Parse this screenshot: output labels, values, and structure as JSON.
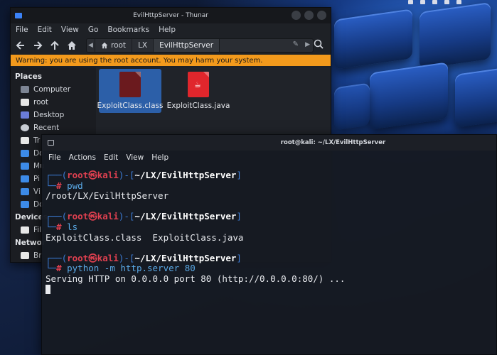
{
  "desktop": {
    "icons": [
      "indicator-icon",
      "network-icon",
      "sound-icon",
      "notification-icon",
      "battery-icon"
    ]
  },
  "thunar": {
    "window_title": "EvilHttpServer - Thunar",
    "menu": [
      "File",
      "Edit",
      "View",
      "Go",
      "Bookmarks",
      "Help"
    ],
    "path": [
      "root",
      "LX",
      "EvilHttpServer"
    ],
    "warning": "Warning: you are using the root account. You may harm your system.",
    "sidebar": {
      "places_header": "Places",
      "places": [
        {
          "label": "Computer",
          "icon": "computer-icon"
        },
        {
          "label": "root",
          "icon": "home-folder-icon"
        },
        {
          "label": "Desktop",
          "icon": "desktop-icon"
        },
        {
          "label": "Recent",
          "icon": "recent-icon"
        },
        {
          "label": "Tr",
          "icon": "trash-icon"
        },
        {
          "label": "Do",
          "icon": "folder-icon"
        },
        {
          "label": "Mu",
          "icon": "music-icon"
        },
        {
          "label": "Pi",
          "icon": "pictures-icon"
        },
        {
          "label": "Vi",
          "icon": "videos-icon"
        },
        {
          "label": "Do",
          "icon": "downloads-icon"
        }
      ],
      "devices_header": "Devices",
      "devices": [
        {
          "label": "Fil",
          "icon": "drive-icon"
        }
      ],
      "network_header": "Networ",
      "network": [
        {
          "label": "Br",
          "icon": "browse-network-icon"
        }
      ]
    },
    "files": [
      {
        "name": "ExploitClass.class",
        "icon": "class-file-icon",
        "selected": true
      },
      {
        "name": "ExploitClass.java",
        "icon": "java-file-icon",
        "selected": false
      }
    ],
    "colors": {
      "warning_bg": "#f39a1c",
      "selection": "#2c5fa8"
    }
  },
  "terminal": {
    "window_title": "root@kali: ~/LX/EvilHttpServer",
    "menu": [
      "File",
      "Actions",
      "Edit",
      "View",
      "Help"
    ],
    "prompt": {
      "user": "root",
      "at": "㉿",
      "host": "kali",
      "dir": "~/LX/EvilHttpServer"
    },
    "entries": [
      {
        "command": "pwd",
        "output": [
          "/root/LX/EvilHttpServer"
        ]
      },
      {
        "command": "ls",
        "output": [
          "ExploitClass.class  ExploitClass.java"
        ]
      },
      {
        "command": "python -m http.server 80",
        "output": [
          "Serving HTTP on 0.0.0.0 port 80 (http://0.0.0.0:80/) ..."
        ]
      }
    ],
    "colors": {
      "frame": "#3c7cd6",
      "user": "#e04050",
      "command": "#5aa9e6"
    }
  }
}
